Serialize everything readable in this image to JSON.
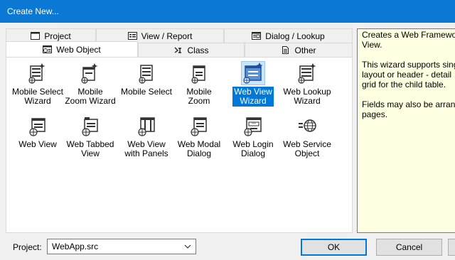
{
  "window": {
    "title": "Create New..."
  },
  "tabs": {
    "back_row": [
      {
        "label": "Project",
        "icon": "window-icon"
      },
      {
        "label": "View / Report",
        "icon": "form-icon"
      },
      {
        "label": "Dialog / Lookup",
        "icon": "dialog-icon"
      }
    ],
    "front_row": [
      {
        "label": "Web Object",
        "icon": "web-form-icon",
        "active": true
      },
      {
        "label": "Class",
        "icon": "class-icon"
      },
      {
        "label": "Other",
        "icon": "document-icon"
      }
    ]
  },
  "items": [
    {
      "label": "Mobile Select\nWizard",
      "icon": "mobile-select-wizard-icon"
    },
    {
      "label": "Mobile\nZoom Wizard",
      "icon": "mobile-zoom-wizard-icon"
    },
    {
      "label": "Mobile Select",
      "icon": "mobile-select-icon"
    },
    {
      "label": "Mobile\nZoom",
      "icon": "mobile-zoom-icon"
    },
    {
      "label": "Web View\nWizard",
      "icon": "web-view-wizard-icon",
      "selected": true
    },
    {
      "label": "Web Lookup\nWizard",
      "icon": "web-lookup-wizard-icon"
    },
    {
      "label": "Web View",
      "icon": "web-view-icon"
    },
    {
      "label": "Web Tabbed\nView",
      "icon": "web-tabbed-view-icon"
    },
    {
      "label": "Web View\nwith Panels",
      "icon": "web-view-panels-icon"
    },
    {
      "label": "Web Modal\nDialog",
      "icon": "web-modal-dialog-icon"
    },
    {
      "label": "Web Login\nDialog",
      "icon": "web-login-dialog-icon"
    },
    {
      "label": "Web Service\nObject",
      "icon": "web-service-object-icon"
    }
  ],
  "description": "Creates a Web Frameworl\nView.\n\nThis wizard supports sing\nlayout or header - detail\ngrid for the child table.\n\nFields may also be arrang\npages.",
  "project": {
    "label": "Project:",
    "value": "WebApp.src"
  },
  "buttons": {
    "ok": "OK",
    "cancel": "Cancel"
  },
  "colors": {
    "title_bar": "#0b78d4",
    "selection": "#0078d7",
    "description_bg": "#ffffe1"
  }
}
